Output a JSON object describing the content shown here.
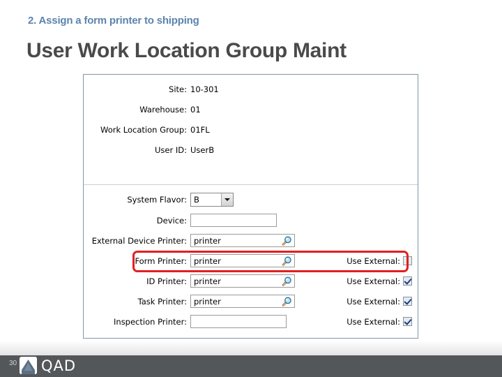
{
  "slide": {
    "subtitle": "2. Assign a form printer to shipping",
    "title": "User Work Location Group Maint",
    "subtitle_color": "#5b84ad",
    "title_color": "#4a4a4a"
  },
  "app": {
    "header_fields": [
      {
        "label": "Site:",
        "value": "10-301"
      },
      {
        "label": "Warehouse:",
        "value": "01"
      },
      {
        "label": "Work Location Group:",
        "value": "01FL"
      },
      {
        "label": "User ID:",
        "value": "UserB"
      }
    ],
    "system_flavor": {
      "label": "System Flavor:",
      "value": "B",
      "options": [
        "B"
      ]
    },
    "device": {
      "label": "Device:",
      "value": "",
      "placeholder": ""
    },
    "printer_rows": [
      {
        "label": "External Device Printer:",
        "value": "printer",
        "has_lookup": true,
        "has_use_external": false,
        "use_external_label": "",
        "checked": false,
        "highlighted": false
      },
      {
        "label": "Form Printer:",
        "value": "printer",
        "has_lookup": true,
        "has_use_external": true,
        "use_external_label": "Use External:",
        "checked": false,
        "highlighted": true
      },
      {
        "label": "ID Printer:",
        "value": "printer",
        "has_lookup": true,
        "has_use_external": true,
        "use_external_label": "Use External:",
        "checked": true,
        "highlighted": false
      },
      {
        "label": "Task Printer:",
        "value": "printer",
        "has_lookup": true,
        "has_use_external": true,
        "use_external_label": "Use External:",
        "checked": true,
        "highlighted": false
      },
      {
        "label": "Inspection Printer:",
        "value": "",
        "has_lookup": false,
        "has_use_external": true,
        "use_external_label": "Use External:",
        "checked": true,
        "highlighted": false
      }
    ],
    "highlight_color": "#e02020"
  },
  "footer": {
    "page_number": "30",
    "brand": "QAD",
    "bar_color": "#53575a"
  }
}
